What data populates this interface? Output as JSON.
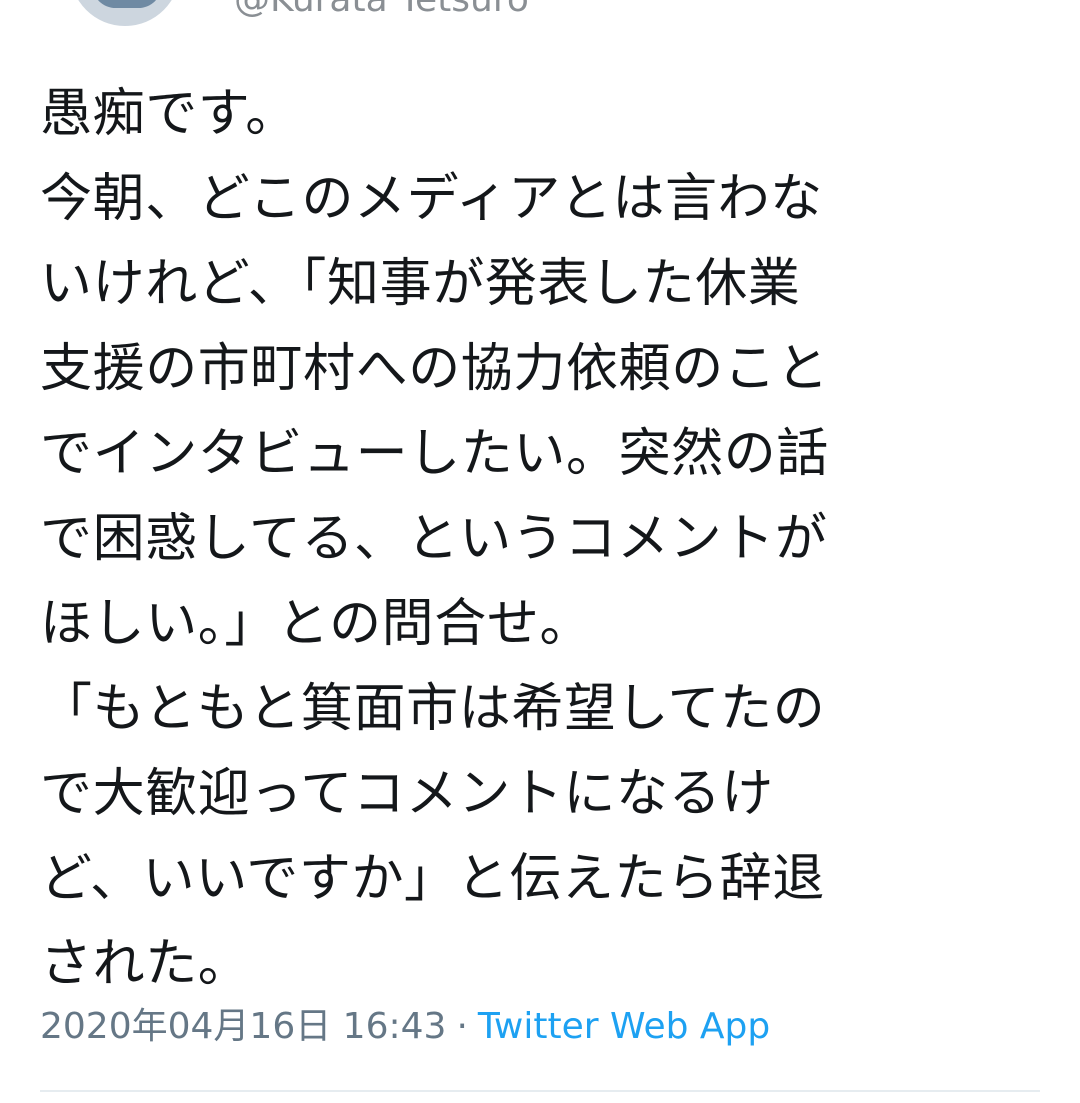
{
  "author": {
    "handle": "@Kurata Tetsuro",
    "avatar_icon": "avatar-icon"
  },
  "tweet": {
    "lines": [
      "愚痴です。",
      "今朝、どこのメディアとは言わな",
      "いけれど、「知事が発表した休業",
      "支援の市町村への協力依頼のこと",
      "でインタビューしたい。突然の話",
      "で困惑してる、というコメントが",
      "ほしい。」との問合せ。",
      "「もともと箕面市は希望してたの",
      "で大歓迎ってコメントになるけ",
      "ど、いいですか」と伝えたら辞退",
      "された。"
    ],
    "timestamp": "2020年04月16日 16:43",
    "separator": "·",
    "source": "Twitter Web App"
  },
  "colors": {
    "text": "#14171a",
    "meta": "#657786",
    "link": "#1da1f2",
    "divider": "#e6ecf0"
  }
}
